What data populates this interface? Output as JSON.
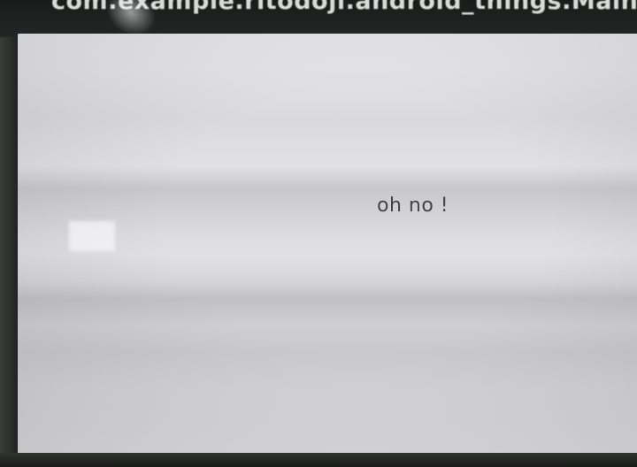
{
  "window": {
    "title": "com.example.ritodoji.android_things.MainActiv"
  },
  "main": {
    "message": "oh no !"
  }
}
